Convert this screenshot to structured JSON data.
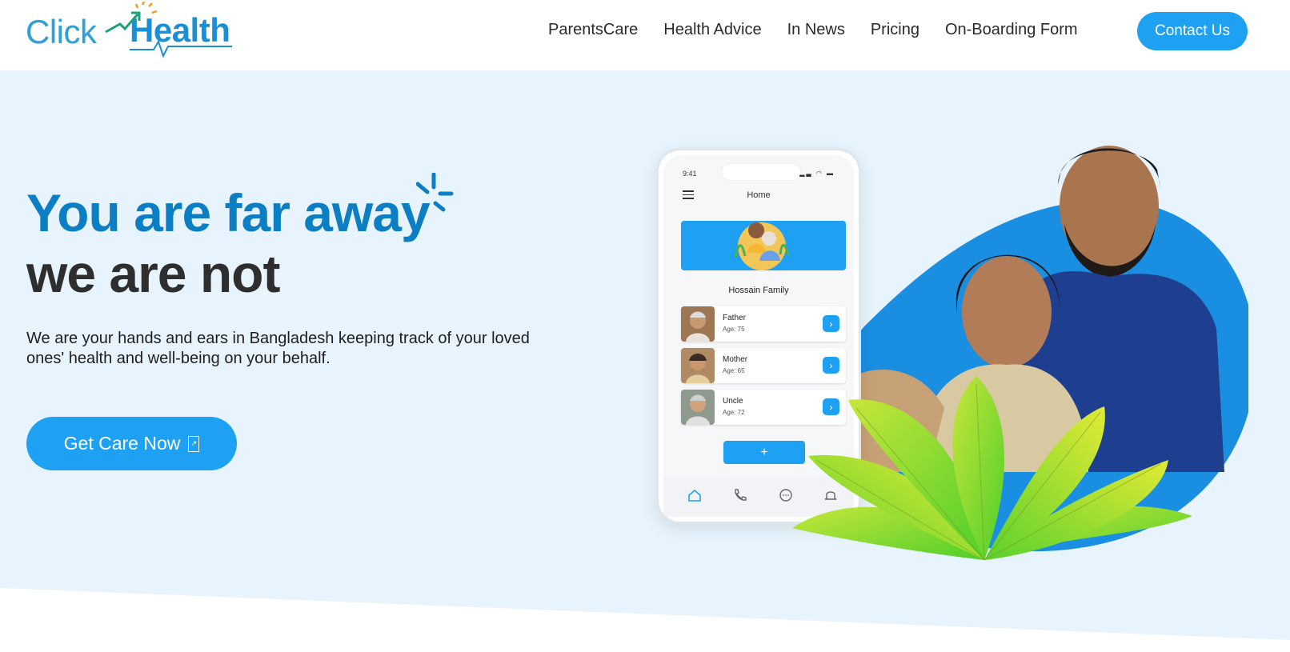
{
  "header": {
    "logo": {
      "click": "Click",
      "health": "Health"
    },
    "nav": [
      {
        "label": "ParentsCare"
      },
      {
        "label": "Health Advice"
      },
      {
        "label": "In News"
      },
      {
        "label": "Pricing"
      },
      {
        "label": "On-Boarding Form"
      }
    ],
    "contact_label": "Contact Us"
  },
  "hero": {
    "headline_1": "You are far away",
    "headline_2": "we are not",
    "subtext": "We are your hands and ears in Bangladesh keeping track of your loved ones' health and well-being on your behalf.",
    "cta_label": "Get Care Now",
    "cta_icon": "external-icon"
  },
  "phone": {
    "time": "9:41",
    "status": "signal wifi battery",
    "title": "Home",
    "family_name": "Hossain Family",
    "members": [
      {
        "name": "Father",
        "age": "Age: 75"
      },
      {
        "name": "Mother",
        "age": "Age: 65"
      },
      {
        "name": "Uncle",
        "age": "Age: 72"
      }
    ],
    "add_label": "+",
    "tabs": [
      "home-icon",
      "phone-icon",
      "chat-icon",
      "bell-icon"
    ]
  },
  "colors": {
    "brand": "#1ea1f2",
    "headline_blue": "#0c7fc4",
    "hero_bg": "#e8f4fd",
    "blob": "#1a8ee0"
  }
}
